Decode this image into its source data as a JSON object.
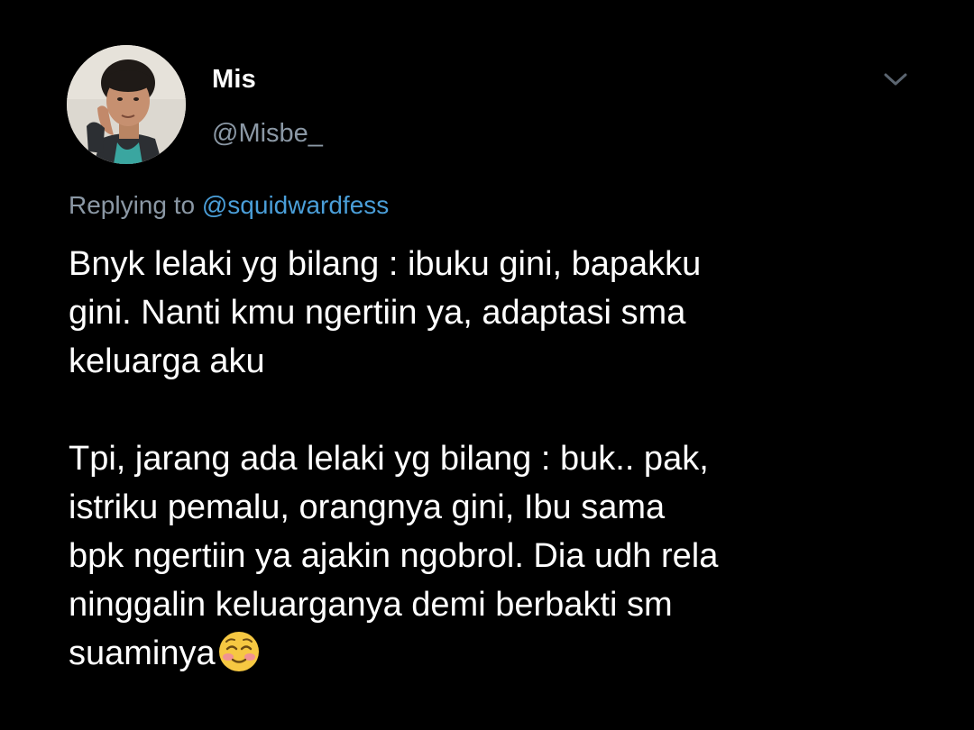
{
  "author": {
    "display_name": "Mis",
    "handle": "@Misbe_",
    "avatar_icon": "profile-photo"
  },
  "menu": {
    "icon": "chevron-down-icon"
  },
  "reply": {
    "prefix": "Replying to",
    "mention": "@squidwardfess"
  },
  "body": {
    "p1": [
      "Bnyk lelaki yg bilang : ibuku gini, bapakku",
      "gini. Nanti kmu ngertiin ya, adaptasi sma",
      "keluarga aku"
    ],
    "p2": [
      "Tpi, jarang ada lelaki yg bilang : buk.. pak,",
      "istriku pemalu, orangnya gini, Ibu sama",
      "bpk ngertiin ya ajakin ngobrol. Dia udh rela",
      "ninggalin keluarganya demi berbakti sm",
      "suaminya"
    ],
    "emoji": "smiling-face-emoji"
  },
  "colors": {
    "background": "#000000",
    "text": "#ffffff",
    "secondary": "#8b98a5",
    "link": "#4a9ed8"
  }
}
